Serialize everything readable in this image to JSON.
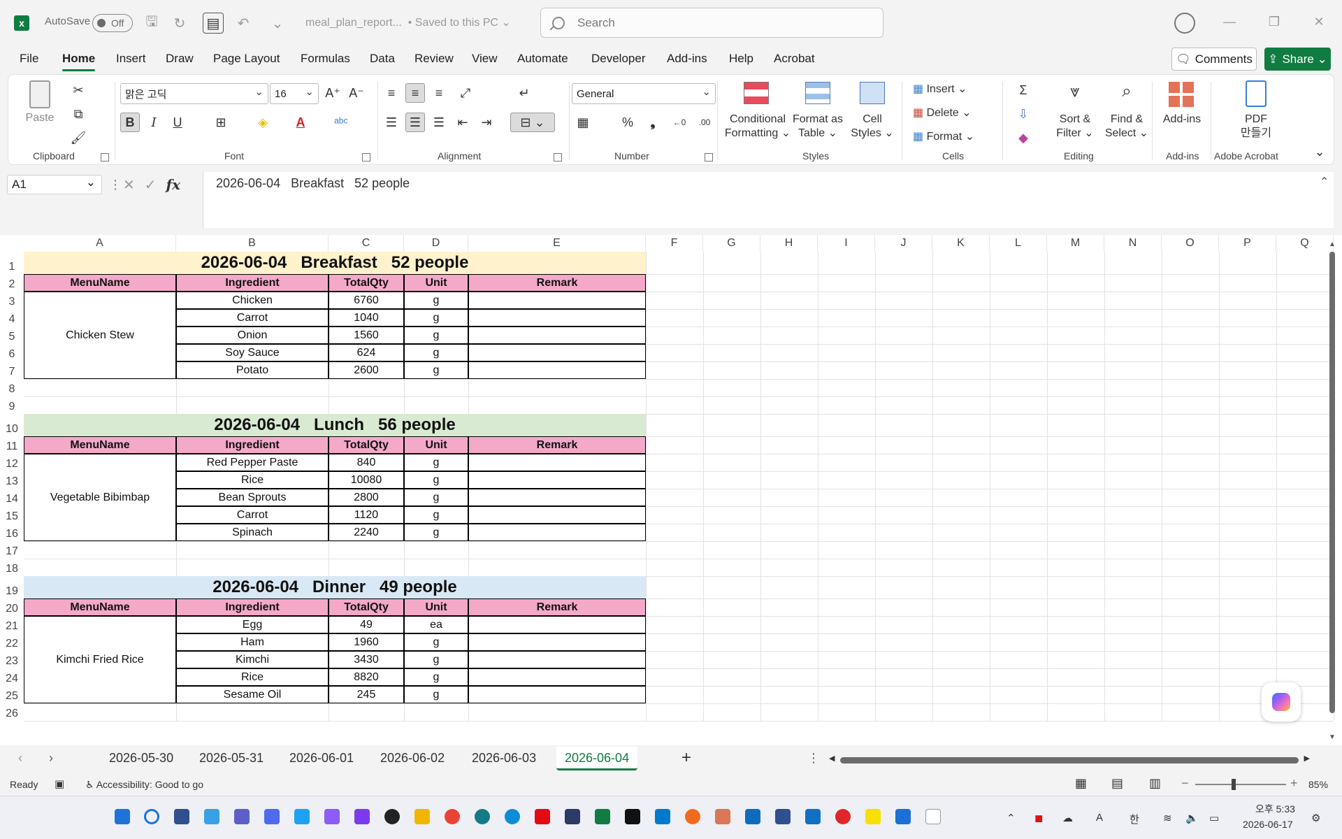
{
  "titlebar": {
    "app_icon": "excel-icon",
    "autosave_label": "AutoSave",
    "autosave_state": "Off",
    "doc_name": "meal_plan_report...",
    "save_status": "• Saved to this PC ⌄",
    "search_placeholder": "Search"
  },
  "menu": {
    "tabs": [
      "File",
      "Home",
      "Insert",
      "Draw",
      "Page Layout",
      "Formulas",
      "Data",
      "Review",
      "View",
      "Automate",
      "Developer",
      "Add-ins",
      "Help",
      "Acrobat"
    ],
    "active": "Home",
    "comments_label": "Comments",
    "share_label": "Share ⌄"
  },
  "ribbon": {
    "clipboard": {
      "paste_label": "Paste",
      "group": "Clipboard"
    },
    "font": {
      "name": "맑은 고딕",
      "size": "16",
      "group": "Font"
    },
    "alignment": {
      "group": "Alignment"
    },
    "number": {
      "format": "General",
      "group": "Number"
    },
    "styles": {
      "cond_label_1": "Conditional",
      "cond_label_2": "Formatting ⌄",
      "table_label_1": "Format as",
      "table_label_2": "Table ⌄",
      "cellstyles_label_1": "Cell",
      "cellstyles_label_2": "Styles ⌄",
      "group": "Styles"
    },
    "cells": {
      "insert": "Insert",
      "delete": "Delete",
      "format": "Format",
      "group": "Cells"
    },
    "editing": {
      "sort_1": "Sort &",
      "sort_2": "Filter ⌄",
      "find_1": "Find &",
      "find_2": "Select ⌄",
      "group": "Editing"
    },
    "addins": {
      "label": "Add-ins",
      "group": "Add-ins"
    },
    "acrobat": {
      "label_1": "PDF",
      "label_2": "만들기",
      "group": "Adobe Acrobat"
    }
  },
  "formula_bar": {
    "name_box": "A1",
    "content": "2026-06-04   Breakfast   52 people"
  },
  "columns": [
    "A",
    "B",
    "C",
    "D",
    "E",
    "F",
    "G",
    "H",
    "I",
    "J",
    "K",
    "L",
    "M",
    "N",
    "O",
    "P",
    "Q"
  ],
  "rows": [
    "1",
    "2",
    "3",
    "4",
    "5",
    "6",
    "7",
    "8",
    "9",
    "10",
    "11",
    "12",
    "13",
    "14",
    "15",
    "16",
    "17",
    "18",
    "19",
    "20",
    "21",
    "22",
    "23",
    "24",
    "25",
    "26"
  ],
  "table_headers": {
    "menu": "MenuName",
    "ingredient": "Ingredient",
    "qty": "TotalQty",
    "unit": "Unit",
    "remark": "Remark"
  },
  "meals": [
    {
      "title": "2026-06-04   Breakfast   52 people",
      "menu": "Chicken Stew",
      "color": "#fff2cc",
      "items": [
        {
          "ingredient": "Chicken",
          "qty": "6760",
          "unit": "g"
        },
        {
          "ingredient": "Carrot",
          "qty": "1040",
          "unit": "g"
        },
        {
          "ingredient": "Onion",
          "qty": "1560",
          "unit": "g"
        },
        {
          "ingredient": "Soy Sauce",
          "qty": "624",
          "unit": "g"
        },
        {
          "ingredient": "Potato",
          "qty": "2600",
          "unit": "g"
        }
      ]
    },
    {
      "title": "2026-06-04   Lunch   56 people",
      "menu": "Vegetable Bibimbap",
      "color": "#d9ead3",
      "items": [
        {
          "ingredient": "Red Pepper Paste",
          "qty": "840",
          "unit": "g"
        },
        {
          "ingredient": "Rice",
          "qty": "10080",
          "unit": "g"
        },
        {
          "ingredient": "Bean Sprouts",
          "qty": "2800",
          "unit": "g"
        },
        {
          "ingredient": "Carrot",
          "qty": "1120",
          "unit": "g"
        },
        {
          "ingredient": "Spinach",
          "qty": "2240",
          "unit": "g"
        }
      ]
    },
    {
      "title": "2026-06-04   Dinner   49 people",
      "menu": "Kimchi Fried Rice",
      "color": "#d9e8f5",
      "items": [
        {
          "ingredient": "Egg",
          "qty": "49",
          "unit": "ea"
        },
        {
          "ingredient": "Ham",
          "qty": "1960",
          "unit": "g"
        },
        {
          "ingredient": "Kimchi",
          "qty": "3430",
          "unit": "g"
        },
        {
          "ingredient": "Rice",
          "qty": "8820",
          "unit": "g"
        },
        {
          "ingredient": "Sesame Oil",
          "qty": "245",
          "unit": "g"
        }
      ]
    }
  ],
  "sheet_tabs": [
    "2026-05-30",
    "2026-05-31",
    "2026-06-01",
    "2026-06-02",
    "2026-06-03",
    "2026-06-04"
  ],
  "active_sheet": "2026-06-04",
  "status": {
    "ready": "Ready",
    "accessibility": "Accessibility: Good to go",
    "zoom": "85%"
  },
  "taskbar": {
    "time_prefix": "오후 5:33",
    "date": "2026-06-17",
    "ime": "한"
  }
}
